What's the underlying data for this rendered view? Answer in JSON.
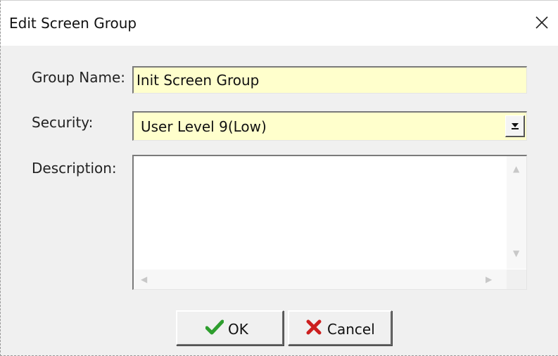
{
  "dialog": {
    "title": "Edit Screen Group",
    "close_glyph": "✕"
  },
  "form": {
    "group_name": {
      "label": "Group Name:",
      "value": "Init Screen Group"
    },
    "security": {
      "label": "Security:",
      "selected": "User Level 9(Low)"
    },
    "description": {
      "label": "Description:",
      "value": ""
    }
  },
  "buttons": {
    "ok": {
      "label": "OK",
      "icon": "checkmark-icon",
      "color": "#2e9e2e"
    },
    "cancel": {
      "label": "Cancel",
      "icon": "x-mark-icon",
      "color": "#cc1f1f"
    }
  },
  "colors": {
    "field_background": "#ffffcc",
    "dialog_background": "#f0f0f0",
    "titlebar_background": "#ffffff"
  }
}
